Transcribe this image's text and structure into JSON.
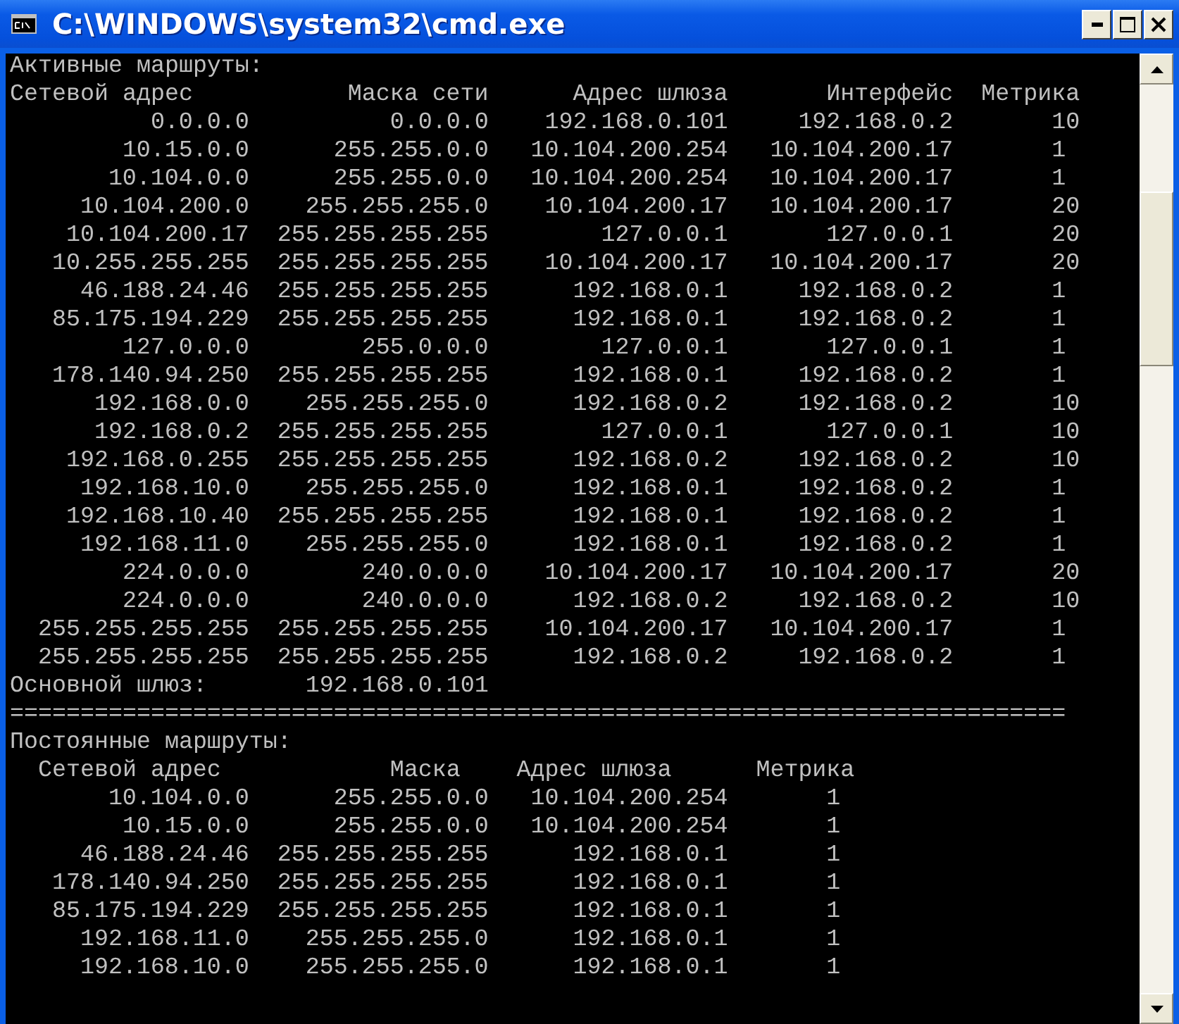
{
  "window": {
    "title": "C:\\WINDOWS\\system32\\cmd.exe"
  },
  "console": {
    "active_routes": {
      "heading": "Активные маршруты:",
      "columns": [
        "Сетевой адрес",
        "Маска сети",
        "Адрес шлюза",
        "Интерфейс",
        "Метрика"
      ],
      "rows": [
        [
          "0.0.0.0",
          "0.0.0.0",
          "192.168.0.101",
          "192.168.0.2",
          "10"
        ],
        [
          "10.15.0.0",
          "255.255.0.0",
          "10.104.200.254",
          "10.104.200.17",
          "1"
        ],
        [
          "10.104.0.0",
          "255.255.0.0",
          "10.104.200.254",
          "10.104.200.17",
          "1"
        ],
        [
          "10.104.200.0",
          "255.255.255.0",
          "10.104.200.17",
          "10.104.200.17",
          "20"
        ],
        [
          "10.104.200.17",
          "255.255.255.255",
          "127.0.0.1",
          "127.0.0.1",
          "20"
        ],
        [
          "10.255.255.255",
          "255.255.255.255",
          "10.104.200.17",
          "10.104.200.17",
          "20"
        ],
        [
          "46.188.24.46",
          "255.255.255.255",
          "192.168.0.1",
          "192.168.0.2",
          "1"
        ],
        [
          "85.175.194.229",
          "255.255.255.255",
          "192.168.0.1",
          "192.168.0.2",
          "1"
        ],
        [
          "127.0.0.0",
          "255.0.0.0",
          "127.0.0.1",
          "127.0.0.1",
          "1"
        ],
        [
          "178.140.94.250",
          "255.255.255.255",
          "192.168.0.1",
          "192.168.0.2",
          "1"
        ],
        [
          "192.168.0.0",
          "255.255.255.0",
          "192.168.0.2",
          "192.168.0.2",
          "10"
        ],
        [
          "192.168.0.2",
          "255.255.255.255",
          "127.0.0.1",
          "127.0.0.1",
          "10"
        ],
        [
          "192.168.0.255",
          "255.255.255.255",
          "192.168.0.2",
          "192.168.0.2",
          "10"
        ],
        [
          "192.168.10.0",
          "255.255.255.0",
          "192.168.0.1",
          "192.168.0.2",
          "1"
        ],
        [
          "192.168.10.40",
          "255.255.255.255",
          "192.168.0.1",
          "192.168.0.2",
          "1"
        ],
        [
          "192.168.11.0",
          "255.255.255.0",
          "192.168.0.1",
          "192.168.0.2",
          "1"
        ],
        [
          "224.0.0.0",
          "240.0.0.0",
          "10.104.200.17",
          "10.104.200.17",
          "20"
        ],
        [
          "224.0.0.0",
          "240.0.0.0",
          "192.168.0.2",
          "192.168.0.2",
          "10"
        ],
        [
          "255.255.255.255",
          "255.255.255.255",
          "10.104.200.17",
          "10.104.200.17",
          "1"
        ],
        [
          "255.255.255.255",
          "255.255.255.255",
          "192.168.0.2",
          "192.168.0.2",
          "1"
        ]
      ]
    },
    "default_gateway": {
      "label": "Основной шлюз:",
      "value": "192.168.0.101"
    },
    "separator": "===========================================================================",
    "persistent_routes": {
      "heading": "Постоянные маршруты:",
      "columns": [
        "Сетевой адрес",
        "Маска",
        "Адрес шлюза",
        "Метрика"
      ],
      "rows": [
        [
          "10.104.0.0",
          "255.255.0.0",
          "10.104.200.254",
          "1"
        ],
        [
          "10.15.0.0",
          "255.255.0.0",
          "10.104.200.254",
          "1"
        ],
        [
          "46.188.24.46",
          "255.255.255.255",
          "192.168.0.1",
          "1"
        ],
        [
          "178.140.94.250",
          "255.255.255.255",
          "192.168.0.1",
          "1"
        ],
        [
          "85.175.194.229",
          "255.255.255.255",
          "192.168.0.1",
          "1"
        ],
        [
          "192.168.11.0",
          "255.255.255.0",
          "192.168.0.1",
          "1"
        ],
        [
          "192.168.10.0",
          "255.255.255.0",
          "192.168.0.1",
          "1"
        ]
      ]
    }
  }
}
